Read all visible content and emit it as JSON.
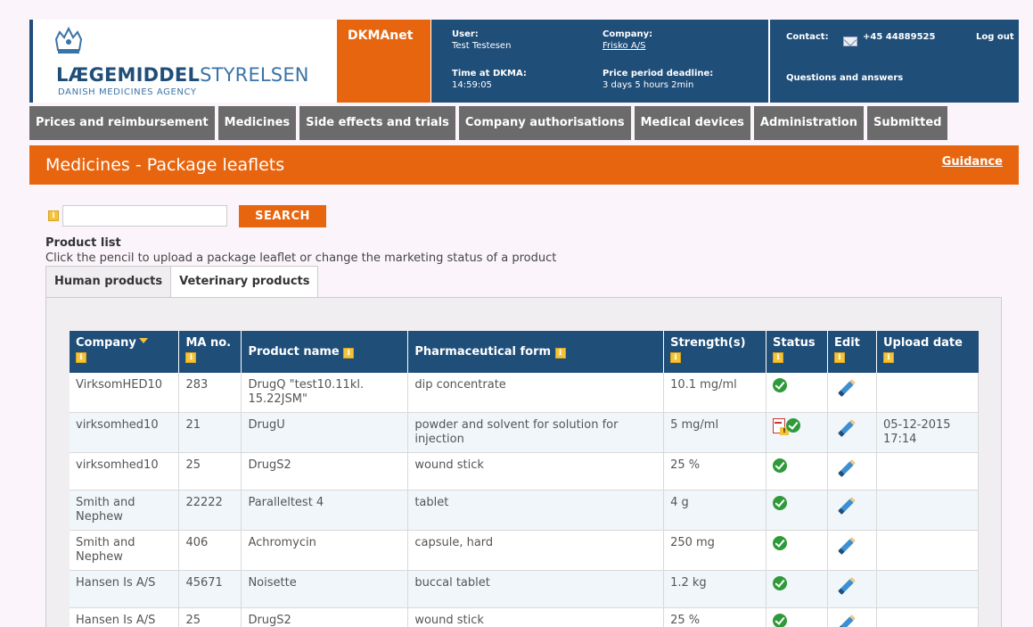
{
  "header": {
    "logo_main_bold": "LÆGEMIDDEL",
    "logo_main_rest": "STYRELSEN",
    "logo_sub": "DANISH MEDICINES AGENCY",
    "app_name": "DKMAnet",
    "user_label": "User:",
    "user_value": "Test Testesen",
    "company_label": "Company:",
    "company_value": "Frisko A/S",
    "time_label": "Time at DKMA:",
    "time_value": "14:59:05",
    "deadline_label": "Price period deadline:",
    "deadline_value": "3 days 5 hours 2min",
    "contact_label": "Contact:",
    "contact_phone": "+45 44889525",
    "logout_label": "Log out",
    "qa_label": "Questions and answers"
  },
  "nav": {
    "items": [
      "Prices and reimbursement",
      "Medicines",
      "Side effects and trials",
      "Company authorisations",
      "Medical devices",
      "Administration",
      "Submitted"
    ]
  },
  "page": {
    "title": "Medicines - Package leaflets",
    "guidance_label": "Guidance"
  },
  "search": {
    "value": "",
    "button_label": "SEARCH"
  },
  "product_list": {
    "title": "Product list",
    "subtitle": "Click the pencil to upload a package leaflet or change the marketing status of a product",
    "tabs": [
      "Human products",
      "Veterinary products"
    ],
    "active_tab": "Human products",
    "columns": [
      "Company",
      "MA no.",
      "Product name",
      "Pharmaceutical form",
      "Strength(s)",
      "Status",
      "Edit",
      "Upload date"
    ],
    "rows": [
      {
        "company": "VirksomHED10",
        "ma": "283",
        "product": "DrugQ \"test10.11kl. 15.22JSM\"",
        "form": "dip concentrate",
        "strength": "10.1 mg/ml",
        "status": "ok",
        "upload": ""
      },
      {
        "company": "virksomhed10",
        "ma": "21",
        "product": "DrugU",
        "form": "powder and solvent for solution for injection",
        "strength": "5 mg/ml",
        "status": "pdf-ok",
        "upload": "05-12-2015 17:14"
      },
      {
        "company": "virksomhed10",
        "ma": "25",
        "product": "DrugS2",
        "form": "wound stick",
        "strength": "25 %",
        "status": "ok",
        "upload": ""
      },
      {
        "company": "Smith and Nephew",
        "ma": "22222",
        "product": "Paralleltest 4",
        "form": "tablet",
        "strength": "4 g",
        "status": "ok",
        "upload": ""
      },
      {
        "company": "Smith and Nephew",
        "ma": "406",
        "product": "Achromycin",
        "form": "capsule, hard",
        "strength": "250 mg",
        "status": "ok",
        "upload": ""
      },
      {
        "company": "Hansen Is A/S",
        "ma": "45671",
        "product": "Noisette",
        "form": "buccal tablet",
        "strength": "1.2 kg",
        "status": "ok",
        "upload": ""
      },
      {
        "company": "Hansen Is A/S",
        "ma": "25",
        "product": "DrugS2",
        "form": "wound stick",
        "strength": "25 %",
        "status": "ok",
        "upload": ""
      }
    ]
  },
  "colors": {
    "brand_blue": "#1f4e79",
    "brand_orange": "#e8650f",
    "nav_grey": "#6b6b6b",
    "status_green": "#2f9a3a"
  }
}
